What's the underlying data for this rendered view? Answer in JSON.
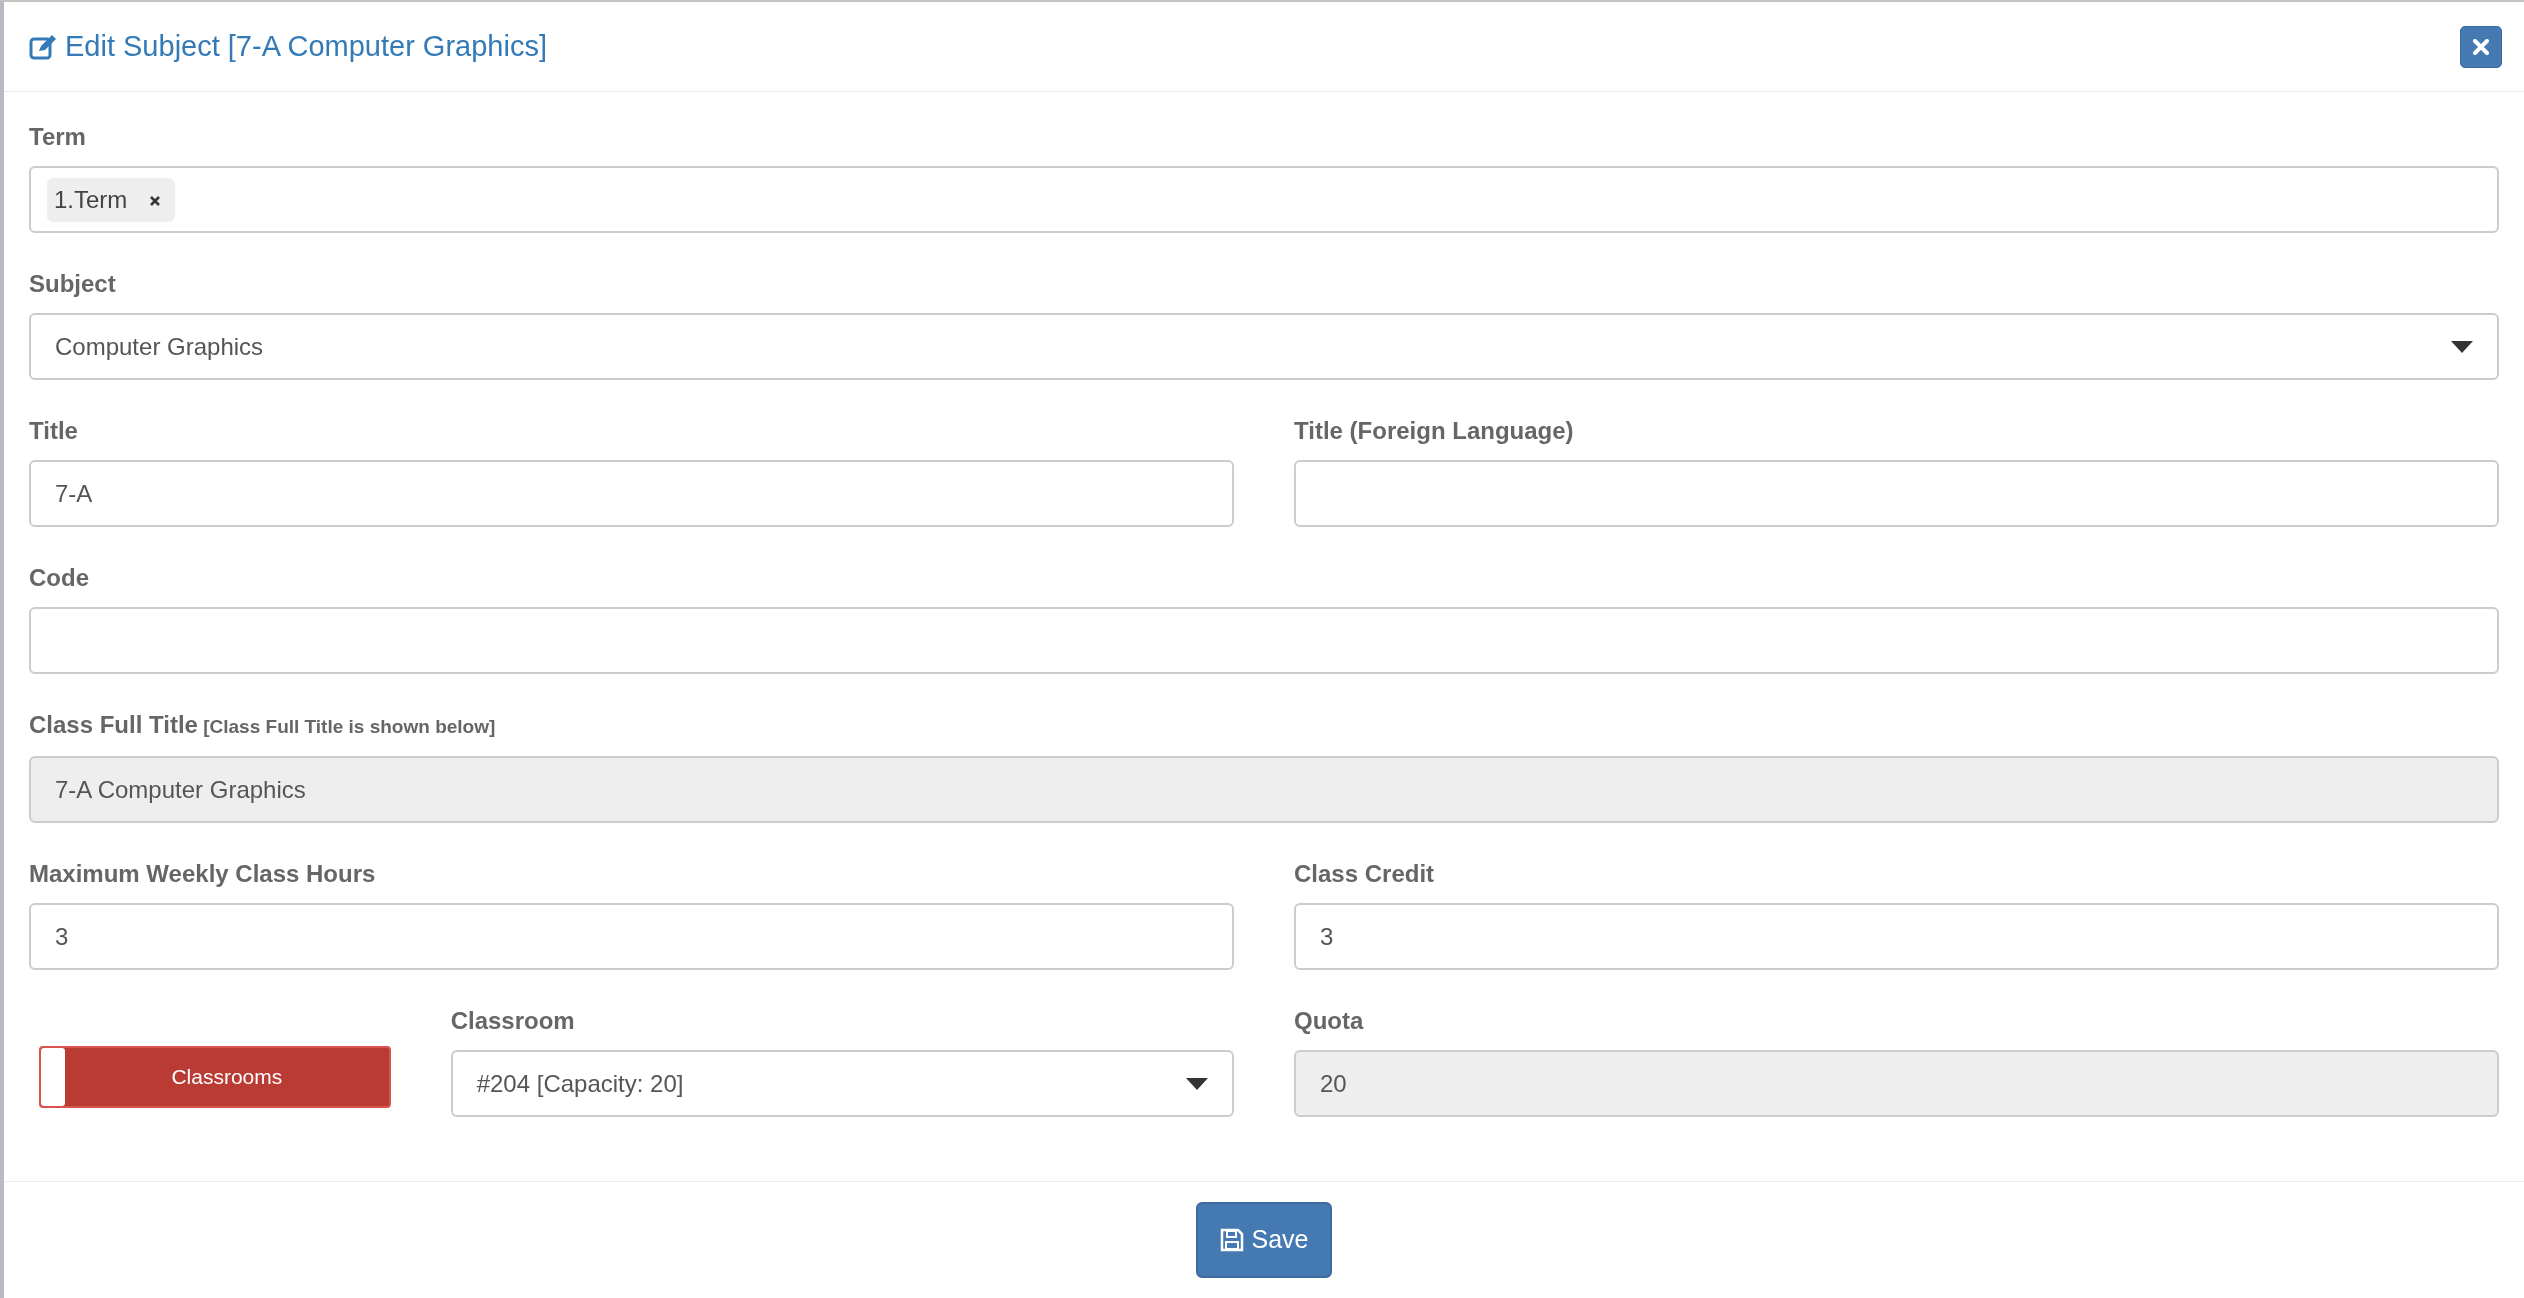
{
  "dialog": {
    "title": "Edit Subject [7-A Computer Graphics]"
  },
  "rows": [
    [
      {
        "kind": "tags",
        "label": "Term",
        "tags": [
          "1.Term"
        ]
      }
    ],
    [
      {
        "kind": "select",
        "label": "Subject",
        "value": "Computer Graphics",
        "readonly": false
      }
    ],
    [
      {
        "kind": "text",
        "label": "Title",
        "value": "7-A",
        "readonly": false
      },
      {
        "kind": "text",
        "label": "Title (Foreign Language)",
        "readonly": false
      }
    ],
    [
      {
        "kind": "text",
        "label": "Code",
        "readonly": false
      }
    ],
    [
      {
        "kind": "text",
        "label": "Class Full Title",
        "note": "[Class Full Title is shown below]",
        "value": "7-A Computer Graphics",
        "readonly": true
      }
    ],
    [
      {
        "kind": "text",
        "label": "Maximum Weekly Class Hours",
        "value": "3",
        "readonly": false
      },
      {
        "kind": "text",
        "label": "Class Credit",
        "value": "3",
        "readonly": false
      }
    ],
    [
      {
        "kind": "toggle",
        "label": "Classrooms",
        "on": false
      },
      {
        "kind": "select",
        "label": "Classroom",
        "value": "#204 [Capacity: 20]",
        "readonly": false
      },
      {
        "kind": "text",
        "label": "Quota",
        "value": "20",
        "readonly": true
      }
    ]
  ],
  "footer": {
    "save": "Save"
  }
}
